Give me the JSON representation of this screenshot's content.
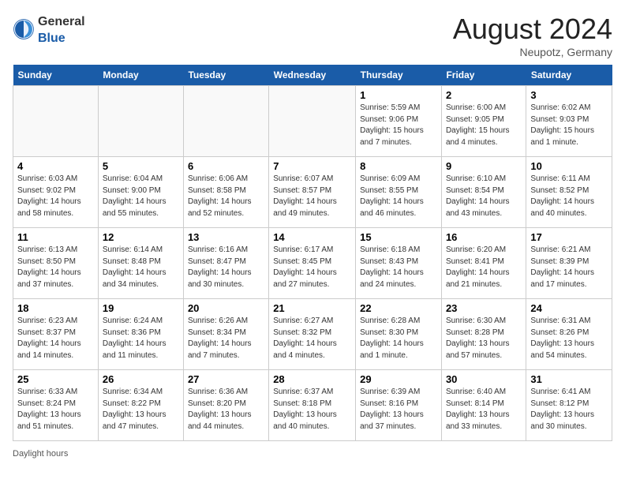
{
  "header": {
    "logo_general": "General",
    "logo_blue": "Blue",
    "month_title": "August 2024",
    "location": "Neupotz, Germany"
  },
  "days_of_week": [
    "Sunday",
    "Monday",
    "Tuesday",
    "Wednesday",
    "Thursday",
    "Friday",
    "Saturday"
  ],
  "weeks": [
    [
      {
        "num": "",
        "info": ""
      },
      {
        "num": "",
        "info": ""
      },
      {
        "num": "",
        "info": ""
      },
      {
        "num": "",
        "info": ""
      },
      {
        "num": "1",
        "info": "Sunrise: 5:59 AM\nSunset: 9:06 PM\nDaylight: 15 hours\nand 7 minutes."
      },
      {
        "num": "2",
        "info": "Sunrise: 6:00 AM\nSunset: 9:05 PM\nDaylight: 15 hours\nand 4 minutes."
      },
      {
        "num": "3",
        "info": "Sunrise: 6:02 AM\nSunset: 9:03 PM\nDaylight: 15 hours\nand 1 minute."
      }
    ],
    [
      {
        "num": "4",
        "info": "Sunrise: 6:03 AM\nSunset: 9:02 PM\nDaylight: 14 hours\nand 58 minutes."
      },
      {
        "num": "5",
        "info": "Sunrise: 6:04 AM\nSunset: 9:00 PM\nDaylight: 14 hours\nand 55 minutes."
      },
      {
        "num": "6",
        "info": "Sunrise: 6:06 AM\nSunset: 8:58 PM\nDaylight: 14 hours\nand 52 minutes."
      },
      {
        "num": "7",
        "info": "Sunrise: 6:07 AM\nSunset: 8:57 PM\nDaylight: 14 hours\nand 49 minutes."
      },
      {
        "num": "8",
        "info": "Sunrise: 6:09 AM\nSunset: 8:55 PM\nDaylight: 14 hours\nand 46 minutes."
      },
      {
        "num": "9",
        "info": "Sunrise: 6:10 AM\nSunset: 8:54 PM\nDaylight: 14 hours\nand 43 minutes."
      },
      {
        "num": "10",
        "info": "Sunrise: 6:11 AM\nSunset: 8:52 PM\nDaylight: 14 hours\nand 40 minutes."
      }
    ],
    [
      {
        "num": "11",
        "info": "Sunrise: 6:13 AM\nSunset: 8:50 PM\nDaylight: 14 hours\nand 37 minutes."
      },
      {
        "num": "12",
        "info": "Sunrise: 6:14 AM\nSunset: 8:48 PM\nDaylight: 14 hours\nand 34 minutes."
      },
      {
        "num": "13",
        "info": "Sunrise: 6:16 AM\nSunset: 8:47 PM\nDaylight: 14 hours\nand 30 minutes."
      },
      {
        "num": "14",
        "info": "Sunrise: 6:17 AM\nSunset: 8:45 PM\nDaylight: 14 hours\nand 27 minutes."
      },
      {
        "num": "15",
        "info": "Sunrise: 6:18 AM\nSunset: 8:43 PM\nDaylight: 14 hours\nand 24 minutes."
      },
      {
        "num": "16",
        "info": "Sunrise: 6:20 AM\nSunset: 8:41 PM\nDaylight: 14 hours\nand 21 minutes."
      },
      {
        "num": "17",
        "info": "Sunrise: 6:21 AM\nSunset: 8:39 PM\nDaylight: 14 hours\nand 17 minutes."
      }
    ],
    [
      {
        "num": "18",
        "info": "Sunrise: 6:23 AM\nSunset: 8:37 PM\nDaylight: 14 hours\nand 14 minutes."
      },
      {
        "num": "19",
        "info": "Sunrise: 6:24 AM\nSunset: 8:36 PM\nDaylight: 14 hours\nand 11 minutes."
      },
      {
        "num": "20",
        "info": "Sunrise: 6:26 AM\nSunset: 8:34 PM\nDaylight: 14 hours\nand 7 minutes."
      },
      {
        "num": "21",
        "info": "Sunrise: 6:27 AM\nSunset: 8:32 PM\nDaylight: 14 hours\nand 4 minutes."
      },
      {
        "num": "22",
        "info": "Sunrise: 6:28 AM\nSunset: 8:30 PM\nDaylight: 14 hours\nand 1 minute."
      },
      {
        "num": "23",
        "info": "Sunrise: 6:30 AM\nSunset: 8:28 PM\nDaylight: 13 hours\nand 57 minutes."
      },
      {
        "num": "24",
        "info": "Sunrise: 6:31 AM\nSunset: 8:26 PM\nDaylight: 13 hours\nand 54 minutes."
      }
    ],
    [
      {
        "num": "25",
        "info": "Sunrise: 6:33 AM\nSunset: 8:24 PM\nDaylight: 13 hours\nand 51 minutes."
      },
      {
        "num": "26",
        "info": "Sunrise: 6:34 AM\nSunset: 8:22 PM\nDaylight: 13 hours\nand 47 minutes."
      },
      {
        "num": "27",
        "info": "Sunrise: 6:36 AM\nSunset: 8:20 PM\nDaylight: 13 hours\nand 44 minutes."
      },
      {
        "num": "28",
        "info": "Sunrise: 6:37 AM\nSunset: 8:18 PM\nDaylight: 13 hours\nand 40 minutes."
      },
      {
        "num": "29",
        "info": "Sunrise: 6:39 AM\nSunset: 8:16 PM\nDaylight: 13 hours\nand 37 minutes."
      },
      {
        "num": "30",
        "info": "Sunrise: 6:40 AM\nSunset: 8:14 PM\nDaylight: 13 hours\nand 33 minutes."
      },
      {
        "num": "31",
        "info": "Sunrise: 6:41 AM\nSunset: 8:12 PM\nDaylight: 13 hours\nand 30 minutes."
      }
    ]
  ],
  "footer": {
    "daylight_label": "Daylight hours"
  }
}
